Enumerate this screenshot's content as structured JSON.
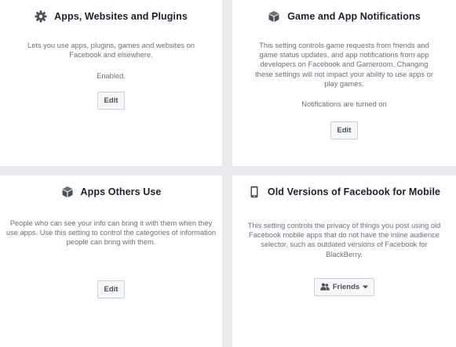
{
  "cards": {
    "apps_websites_plugins": {
      "icon": "gear-icon",
      "title": "Apps, Websites and Plugins",
      "description": "Lets you use apps, plugins, games and websites on Facebook and elsewhere.",
      "status": "Enabled.",
      "button_label": "Edit"
    },
    "game_app_notifications": {
      "icon": "cube-icon",
      "title": "Game and App Notifications",
      "description": "This setting controls game requests from friends and game status updates, and app notifications from app developers on Facebook and Gameroom. Changing these settings will not impact your ability to use apps or play games.",
      "status": "Notifications are turned on",
      "button_label": "Edit"
    },
    "apps_others_use": {
      "icon": "cube-icon",
      "title": "Apps Others Use",
      "description": "People who can see your info can bring it with them when they use apps. Use this setting to control the categories of information people can bring with them.",
      "button_label": "Edit"
    },
    "old_versions_mobile": {
      "icon": "mobile-phone-icon",
      "title": "Old Versions of Facebook for Mobile",
      "description": "This setting controls the privacy of things you post using old Facebook mobile apps that do not have the inline audience selector, such as outdated versions of Facebook for BlackBerry.",
      "audience_label": "Friends",
      "audience_icon": "friends-icon"
    }
  },
  "colors": {
    "page_background": "#e9ebee",
    "card_background": "#ffffff",
    "title_text": "#1d2129",
    "body_text": "#6c7079",
    "button_border": "#ccd0d5",
    "button_background": "#f6f7f9"
  }
}
